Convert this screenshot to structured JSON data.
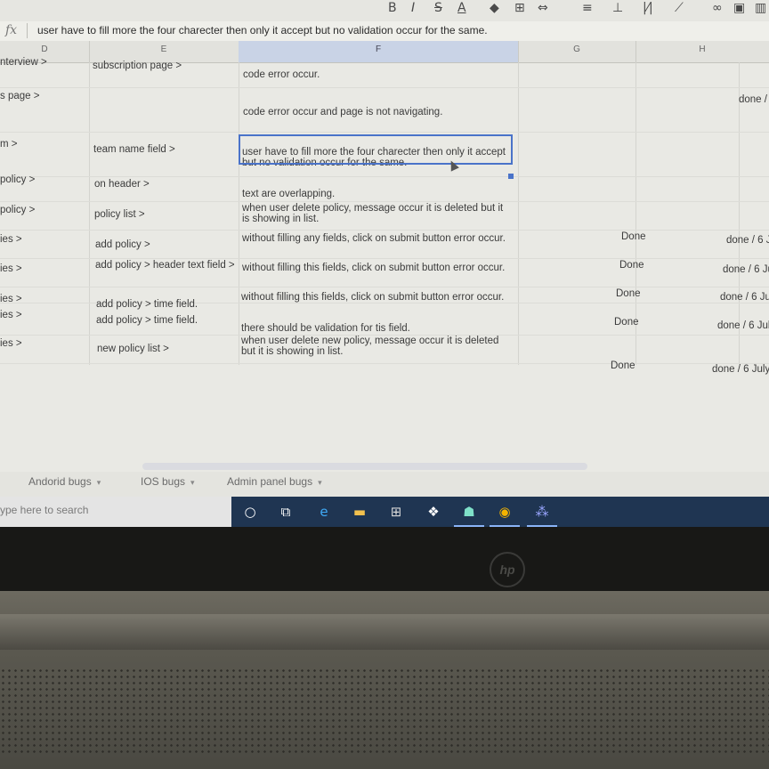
{
  "formula_bar": {
    "fx_label": "fx",
    "text": "user have to fill more the four charecter then only it accept but no validation occur for the same."
  },
  "columns": [
    "D",
    "E",
    "F",
    "G",
    "H"
  ],
  "rows": [
    {
      "d": "nterview >",
      "e": "subscription page >",
      "f": "code error occur.",
      "g": "",
      "h": ""
    },
    {
      "d": "s page >",
      "e": "",
      "f": "code error occur and page is not navigating.",
      "g": "",
      "h": "done /"
    },
    {
      "d": "m >",
      "e": "team name field >",
      "f": "user have to fill more the four charecter then only it accept but no validation occur for the same.",
      "g": "",
      "h": ""
    },
    {
      "d": "policy >",
      "e": "on header >",
      "f": "text are overlapping.",
      "g": "",
      "h": ""
    },
    {
      "d": "policy >",
      "e": "policy list >",
      "f": "when user delete policy, message occur it is deleted but it is showing in list.",
      "g": "",
      "h": ""
    },
    {
      "d": "ies >",
      "e": "add policy >",
      "f": "without filling any fields, click on submit button error occur.",
      "g": "Done",
      "h": "done / 6 J"
    },
    {
      "d": "ies >",
      "e": "add policy > header text field >",
      "f": "without filling this fields, click on submit button error occur.",
      "g": "Done",
      "h": "done / 6 Ju"
    },
    {
      "d": "ies >",
      "e": "add policy > time field.",
      "f": "without filling this fields, click on submit button error occur.",
      "g": "Done",
      "h": "done / 6 Ju"
    },
    {
      "d": "ies >",
      "e": "add policy > time field.",
      "f": "there should be validation for tis field.",
      "g": "Done",
      "h": "done / 6 Jul"
    },
    {
      "d": "ies >",
      "e": "new policy list >",
      "f": "when user delete new policy, message occur it is deleted but it is showing in list.",
      "g": "Done",
      "h": "done / 6 July"
    }
  ],
  "sheet_tabs": [
    "Andorid bugs",
    "IOS bugs",
    "Admin panel bugs"
  ],
  "taskbar": {
    "search_placeholder": "ype here to search"
  },
  "laptop": {
    "logo_text": "hp"
  },
  "colors": {
    "selection": "#4a73c9",
    "taskbar": "#1f3552"
  }
}
